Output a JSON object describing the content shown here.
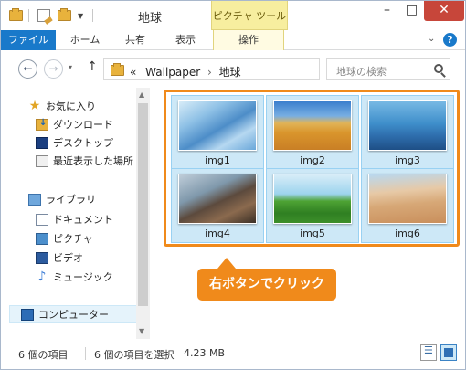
{
  "window": {
    "title": "地球",
    "contextual_tab": "ピクチャ ツール",
    "controls": {
      "minimize": "–",
      "maximize": "□",
      "close": "✕"
    }
  },
  "ribbon": {
    "tabs": [
      "ファイル",
      "ホーム",
      "共有",
      "表示",
      "操作"
    ],
    "collapse_glyph": "⌄",
    "help_glyph": "?"
  },
  "address": {
    "back_glyph": "←",
    "forward_glyph": "→",
    "recent_glyph": "▾",
    "up_glyph": "↑",
    "prefix": "«",
    "crumbs": [
      "Wallpaper",
      "地球"
    ],
    "separator": "›",
    "dropdown_glyph": "▾",
    "refresh_glyph": "↻",
    "search_placeholder": "地球の検索"
  },
  "nav": {
    "favorites": "お気に入り",
    "downloads": "ダウンロード",
    "desktop": "デスクトップ",
    "recent": "最近表示した場所",
    "libraries": "ライブラリ",
    "documents": "ドキュメント",
    "pictures": "ピクチャ",
    "videos": "ビデオ",
    "music": "ミュージック",
    "computer": "コンピューター",
    "scroll_up": "▲",
    "scroll_down": "▼"
  },
  "files": [
    {
      "name": "img1"
    },
    {
      "name": "img2"
    },
    {
      "name": "img3"
    },
    {
      "name": "img4"
    },
    {
      "name": "img5"
    },
    {
      "name": "img6"
    }
  ],
  "callout": "右ボタンでクリック",
  "status": {
    "item_count": "6 個の項目",
    "selected": "6 個の項目を選択",
    "size": "4.23 MB"
  },
  "colors": {
    "accent": "#1979ca",
    "highlight": "#f08a1b",
    "selection": "#cde8f7"
  }
}
